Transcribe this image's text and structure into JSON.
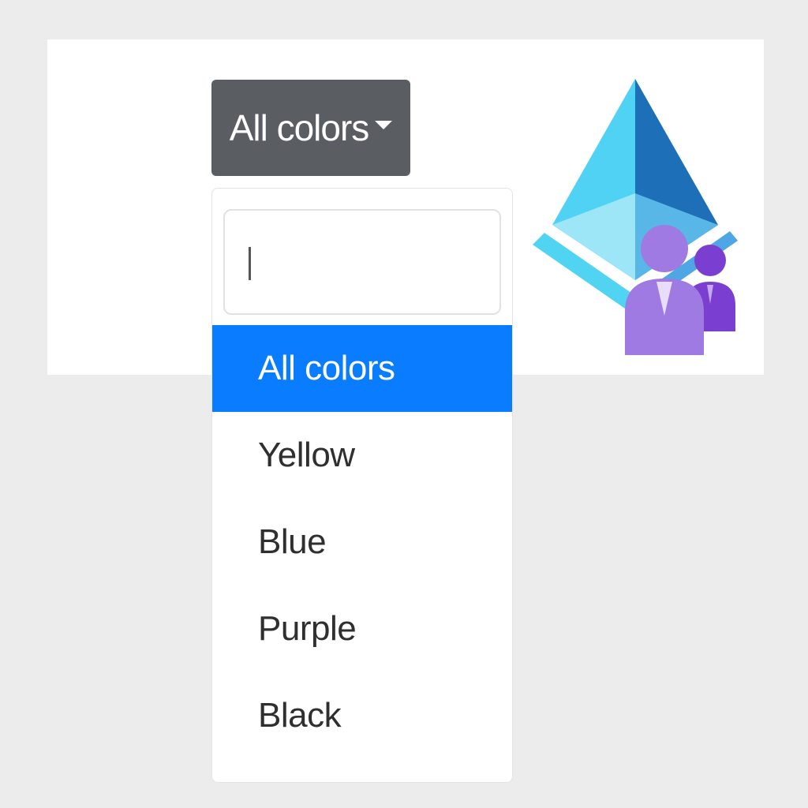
{
  "dropdown": {
    "button_label": "All colors",
    "search": {
      "value": "",
      "placeholder": ""
    },
    "options": [
      {
        "label": "All colors",
        "selected": true
      },
      {
        "label": "Yellow",
        "selected": false
      },
      {
        "label": "Blue",
        "selected": false
      },
      {
        "label": "Purple",
        "selected": false
      },
      {
        "label": "Black",
        "selected": false
      }
    ]
  },
  "logo": {
    "icon": "azure-ad-identity-icon"
  },
  "colors": {
    "background": "#ececec",
    "button": "#5a5e63",
    "active_option": "#0a7cff"
  }
}
